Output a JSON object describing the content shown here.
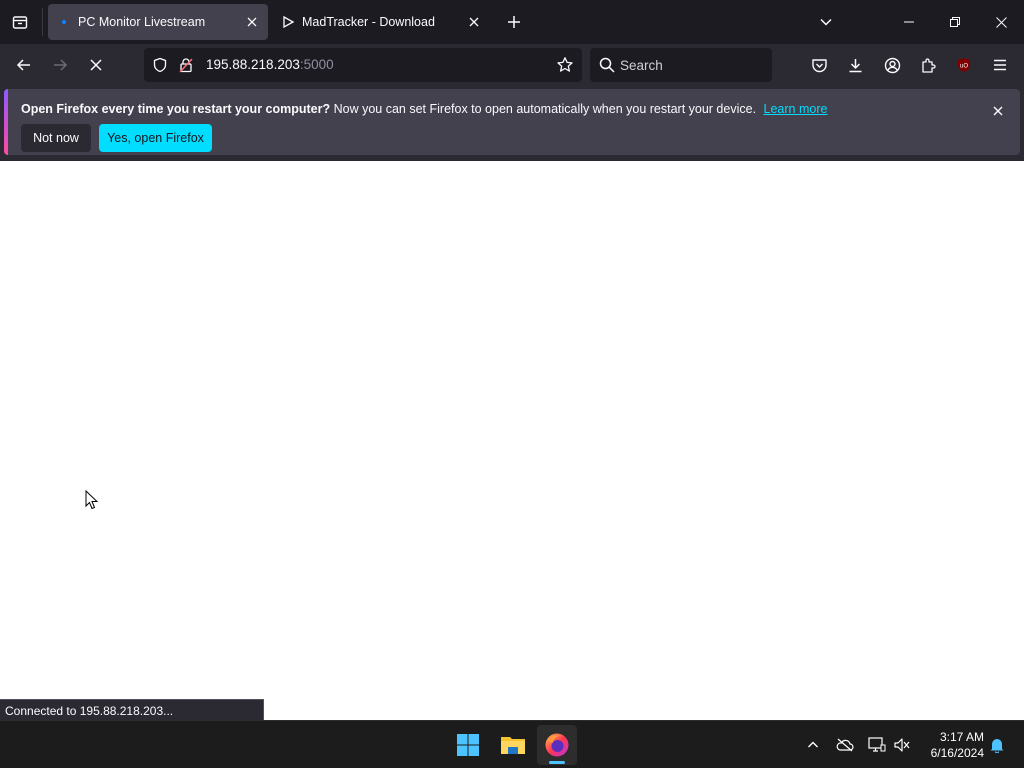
{
  "tabs": [
    {
      "title": "PC Monitor Livestream",
      "active": true
    },
    {
      "title": "MadTracker - Download",
      "active": false
    }
  ],
  "urlbar": {
    "host": "195.88.218.203",
    "port": ":5000"
  },
  "search": {
    "placeholder": "Search"
  },
  "notification": {
    "bold": "Open Firefox every time you restart your computer?",
    "text": "Now you can set Firefox to open automatically when you restart your device.",
    "link": "Learn more",
    "secondary_button": "Not now",
    "primary_button": "Yes, open Firefox"
  },
  "status_bar": {
    "text": "Connected to 195.88.218.203..."
  },
  "taskbar": {
    "time": "3:17 AM",
    "date": "6/16/2024"
  },
  "colors": {
    "accent": "#00ddff",
    "tab_bar": "#1c1b22",
    "toolbar": "#2b2a33",
    "taskbar_indicator": "#4cc2ff",
    "ublock": "#800000"
  },
  "icons": {
    "toolbar": [
      "pocket-icon",
      "download-icon",
      "account-icon",
      "extensions-icon",
      "ublock-origin-icon",
      "menu-icon"
    ],
    "tray": [
      "chevron-up-icon",
      "onedrive-offline-icon",
      "network-icon",
      "volume-muted-icon",
      "notification-bell-icon"
    ]
  }
}
